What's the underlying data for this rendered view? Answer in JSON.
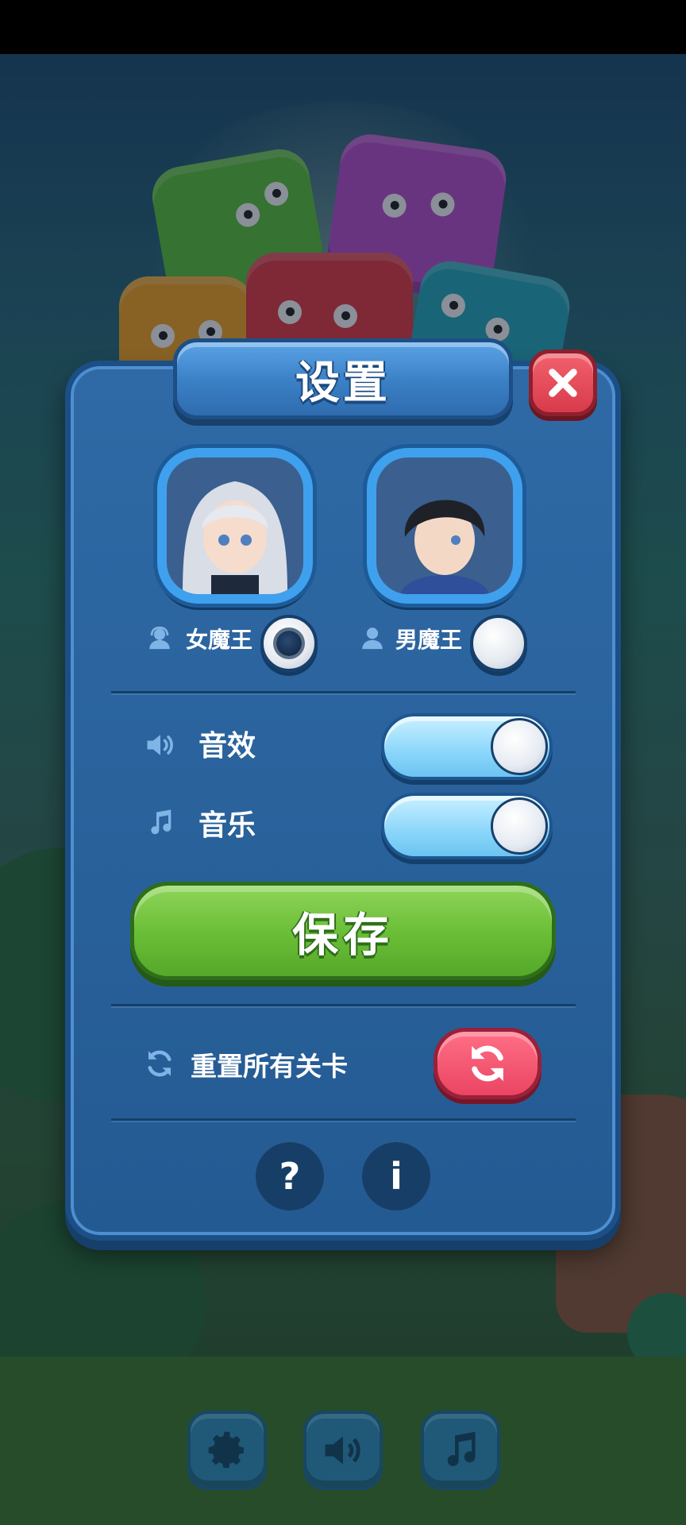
{
  "dialog": {
    "title": "设置",
    "close_icon": "close-icon"
  },
  "heroes": [
    {
      "label": "女魔王",
      "icon": "female-user-icon",
      "selected": true
    },
    {
      "label": "男魔王",
      "icon": "male-user-icon",
      "selected": false
    }
  ],
  "settings": {
    "sound": {
      "label": "音效",
      "icon": "speaker-icon",
      "on": true
    },
    "music": {
      "label": "音乐",
      "icon": "music-note-icon",
      "on": true
    }
  },
  "save_label": "保存",
  "reset": {
    "label": "重置所有关卡",
    "icon": "refresh-icon"
  },
  "footer_buttons": {
    "help": "?",
    "info": "i"
  },
  "bottom_bar": [
    "settings-gear-icon",
    "sound-icon",
    "music-note-icon"
  ],
  "colors": {
    "dialog_blue": "#245a92",
    "save_green": "#69bd35",
    "reset_red": "#ea4563",
    "close_red": "#d83b4b",
    "toggle_on": "#8ad6fb"
  }
}
